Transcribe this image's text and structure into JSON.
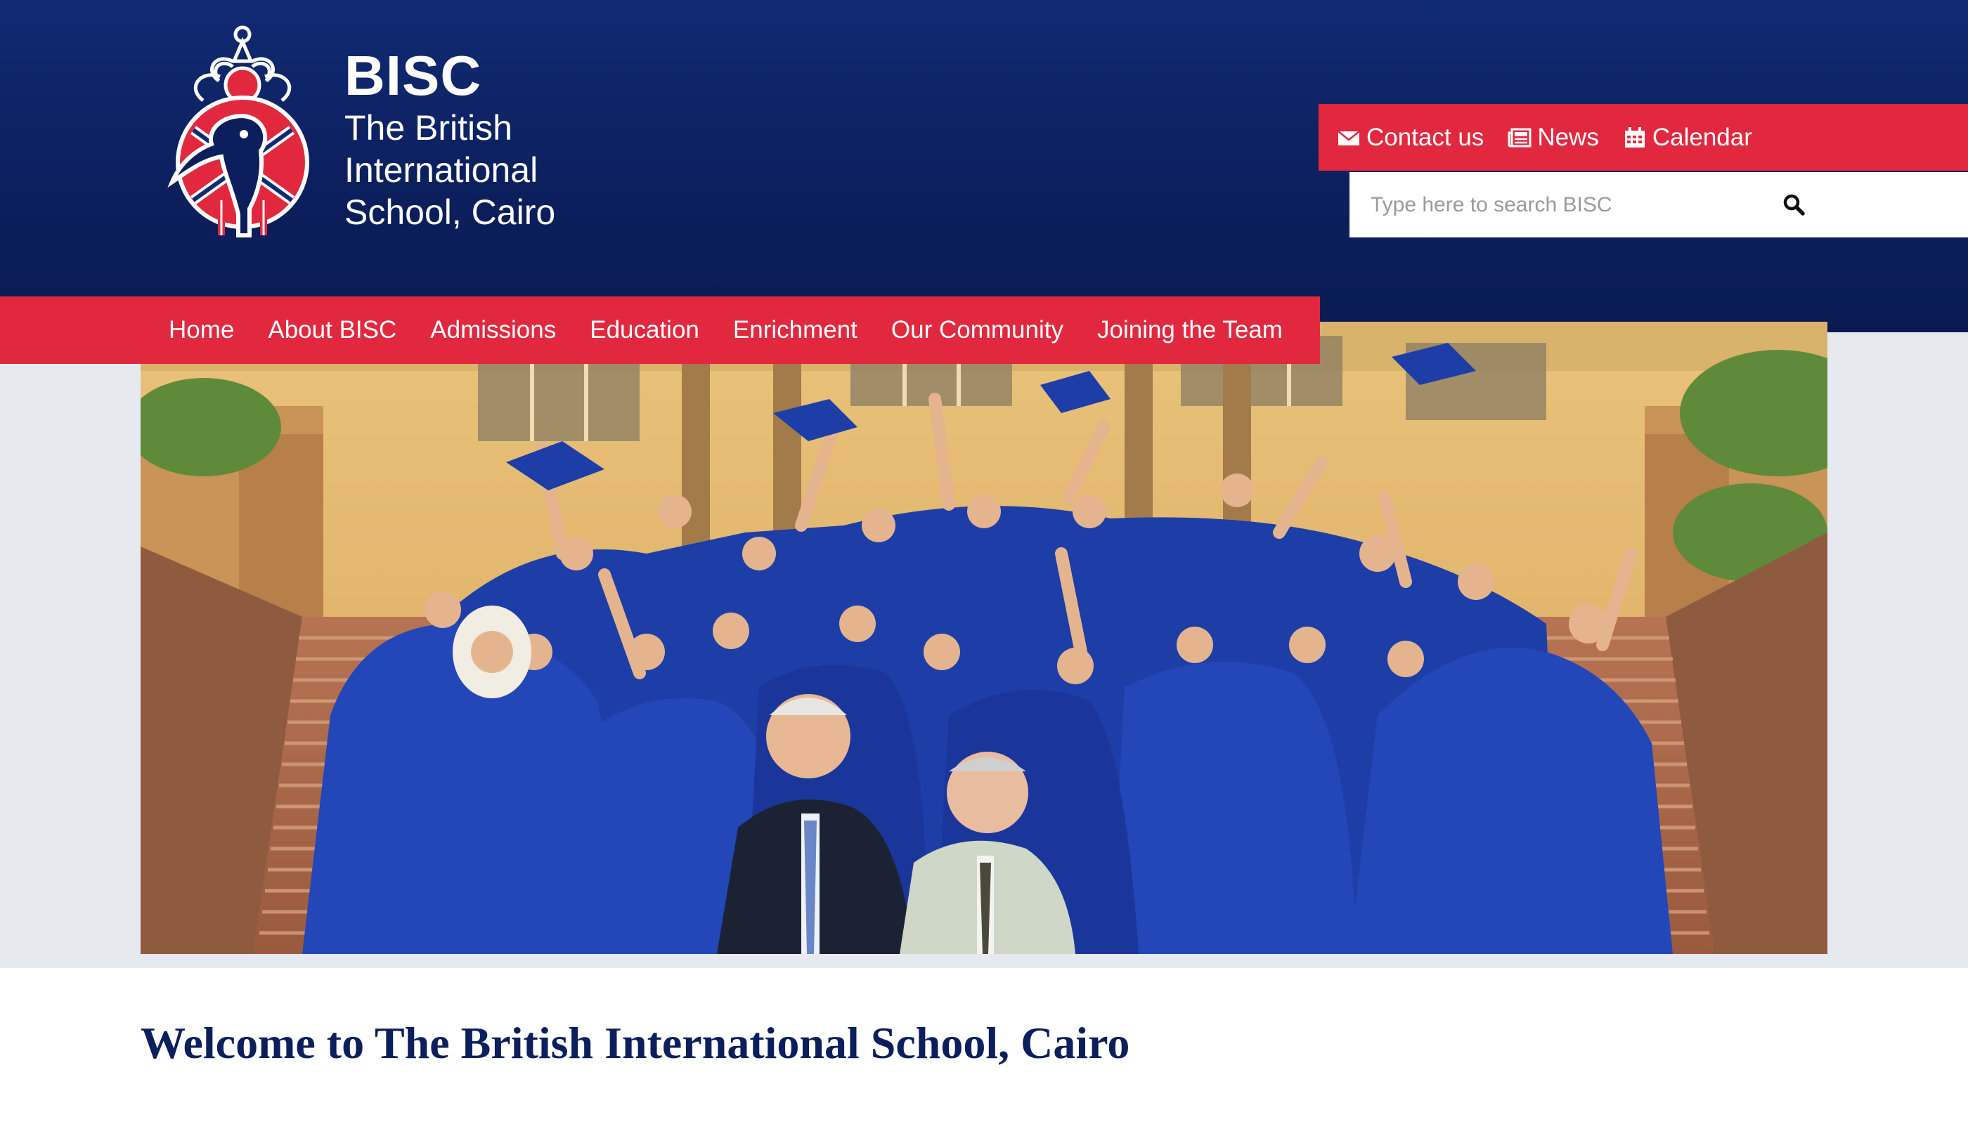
{
  "brand": {
    "abbreviation": "BISC",
    "name": "The British International School, Cairo",
    "logo_icon": "ibis-crest-icon"
  },
  "utility_nav": [
    {
      "label": "Contact us",
      "icon": "envelope-icon"
    },
    {
      "label": "News",
      "icon": "newspaper-icon"
    },
    {
      "label": "Calendar",
      "icon": "calendar-icon"
    }
  ],
  "search": {
    "placeholder": "Type here to search BISC",
    "icon": "search-icon"
  },
  "main_nav": [
    {
      "label": "Home"
    },
    {
      "label": "About BISC"
    },
    {
      "label": "Admissions"
    },
    {
      "label": "Education"
    },
    {
      "label": "Enrichment"
    },
    {
      "label": "Our Community"
    },
    {
      "label": "Joining the Team"
    }
  ],
  "hero": {
    "image": "graduation-photo"
  },
  "welcome": {
    "heading": "Welcome to The British International School, Cairo"
  },
  "colors": {
    "navy": "#0c1f5c",
    "accent_red": "#e2283e",
    "grey_band": "#e7e9f1"
  }
}
